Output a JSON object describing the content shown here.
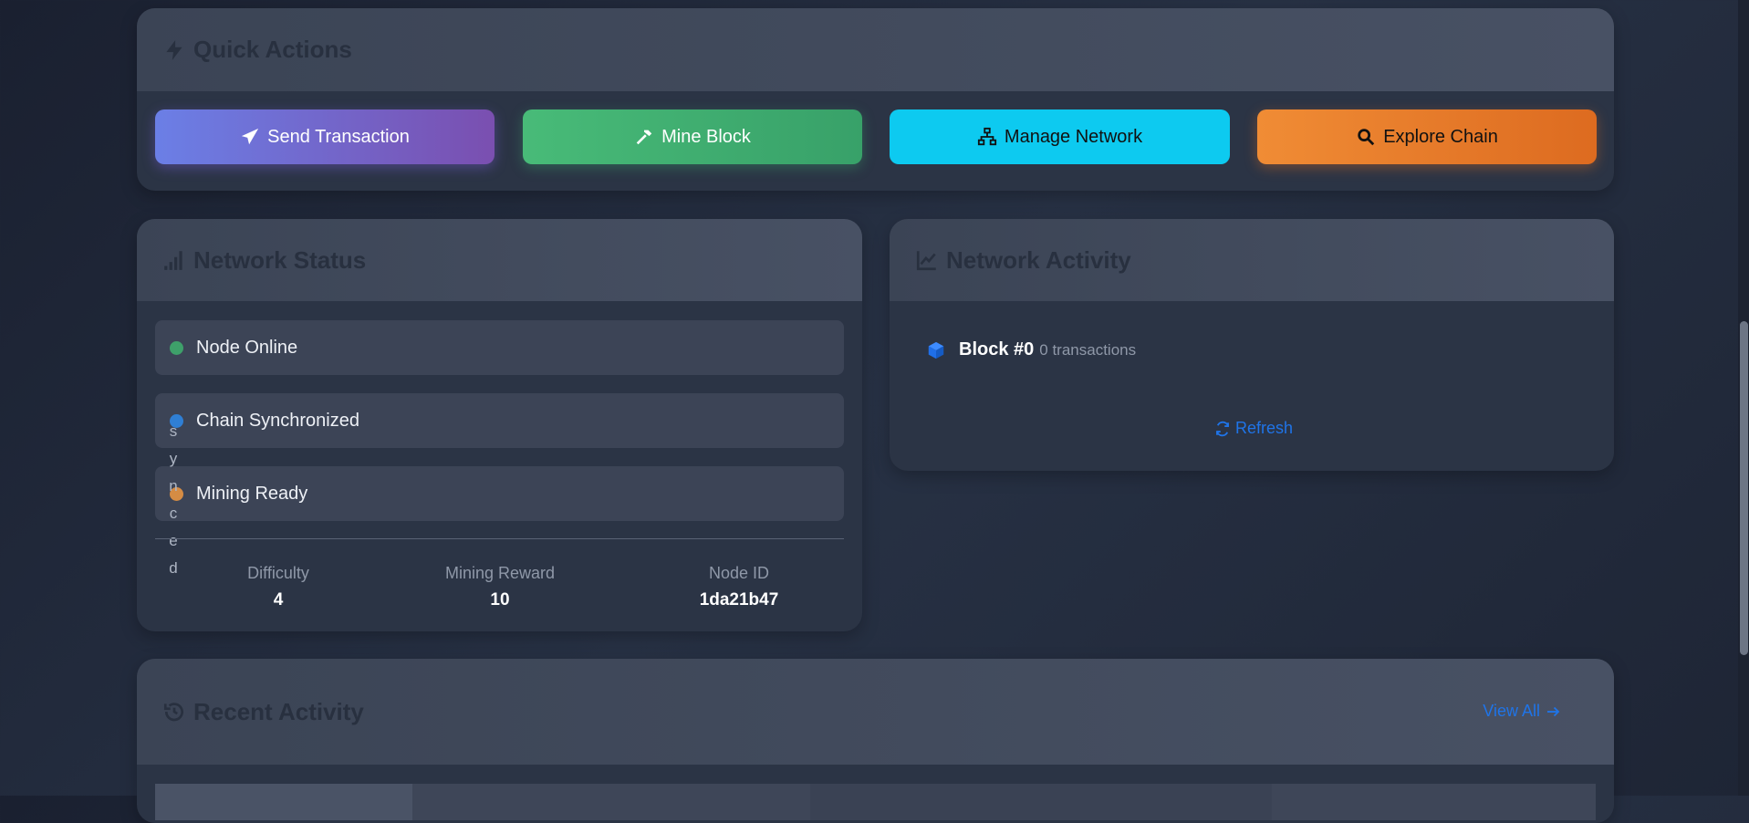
{
  "quick_actions": {
    "title": "Quick Actions",
    "buttons": {
      "send": "Send Transaction",
      "mine": "Mine Block",
      "network": "Manage Network",
      "explore": "Explore Chain"
    }
  },
  "network_status": {
    "title": "Network Status",
    "items": [
      "Node Online",
      "Chain Synchronized",
      "Mining Ready"
    ],
    "overflow_text": [
      "s",
      "y",
      "n",
      "c",
      "e",
      "d"
    ],
    "stats": [
      {
        "label": "Difficulty",
        "value": "4"
      },
      {
        "label": "Mining Reward",
        "value": "10"
      },
      {
        "label": "Node ID",
        "value": "1da21b47"
      }
    ]
  },
  "network_activity": {
    "title": "Network Activity",
    "block": {
      "label": "Block #0",
      "meta": "0 transactions"
    },
    "refresh": "Refresh"
  },
  "recent_activity": {
    "title": "Recent Activity",
    "view_all": "View All"
  },
  "colors": {
    "send": "#7a5fc4",
    "mine": "#3fb071",
    "network": "#0dcaf0",
    "explore": "#f08a30",
    "status_online": "#3ea06a",
    "status_synced": "#2f7fd4",
    "status_mining": "#d58c44",
    "link": "#1f74e8"
  }
}
